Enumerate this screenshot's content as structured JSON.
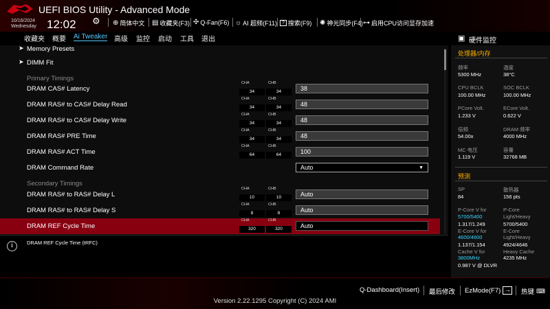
{
  "header": {
    "title": "UEFI BIOS Utility - Advanced Mode",
    "date": "10/16/2024",
    "day": "Wednesday",
    "time": "12:02",
    "items": [
      {
        "icon": "globe-icon",
        "label": "简体中文"
      },
      {
        "icon": "favorites-icon",
        "label": "收藏夹(F3)"
      },
      {
        "icon": "fan-icon",
        "label": "Q-Fan(F6)"
      },
      {
        "icon": "ai-icon",
        "label": "AI 超频(F11)"
      },
      {
        "icon": "help-icon",
        "label": "搜索(F9)"
      },
      {
        "icon": "aura-icon",
        "label": "神光同步(F4)"
      },
      {
        "icon": "cpu-access-icon",
        "label": "启用CPU访问显存加速"
      }
    ]
  },
  "menu": {
    "items": [
      "收藏夹",
      "概要",
      "Ai Tweaker",
      "高级",
      "监控",
      "启动",
      "工具",
      "退出"
    ],
    "active": "Ai Tweaker"
  },
  "main": {
    "rows": [
      {
        "type": "link",
        "label": "Memory Presets"
      },
      {
        "type": "link",
        "label": "DIMM Fit"
      },
      {
        "type": "group",
        "label": "Primary Timings"
      },
      {
        "type": "setting",
        "label": "DRAM CAS# Latency",
        "cha_tag": "CHA",
        "chb_tag": "CHB",
        "cha": "34",
        "chb": "34",
        "value": "38"
      },
      {
        "type": "setting",
        "label": "DRAM RAS# to CAS# Delay Read",
        "cha_tag": "CHA",
        "chb_tag": "CHB",
        "cha": "34",
        "chb": "34",
        "value": "48"
      },
      {
        "type": "setting",
        "label": "DRAM RAS# to CAS# Delay Write",
        "cha_tag": "CHA",
        "chb_tag": "CHB",
        "cha": "34",
        "chb": "34",
        "value": "48"
      },
      {
        "type": "setting",
        "label": "DRAM RAS# PRE Time",
        "cha_tag": "CHA",
        "chb_tag": "CHB",
        "cha": "34",
        "chb": "34",
        "value": "48"
      },
      {
        "type": "setting",
        "label": "DRAM RAS# ACT Time",
        "cha_tag": "CHA",
        "chb_tag": "CHB",
        "cha": "64",
        "chb": "64",
        "value": "100"
      },
      {
        "type": "dropdown",
        "label": "DRAM Command Rate",
        "value": "Auto"
      },
      {
        "type": "group",
        "label": "Secondary Timings"
      },
      {
        "type": "setting",
        "label": "DRAM RAS# to RAS# Delay L",
        "cha_tag": "CHA",
        "chb_tag": "CHB",
        "cha": "10",
        "chb": "10",
        "value": "Auto"
      },
      {
        "type": "setting",
        "label": "DRAM RAS# to RAS# Delay S",
        "cha_tag": "CHA",
        "chb_tag": "CHB",
        "cha": "8",
        "chb": "8",
        "value": "Auto"
      },
      {
        "type": "setting",
        "label": "DRAM REF Cycle Time",
        "cha_tag": "CHA",
        "chb_tag": "CHB",
        "cha": "320",
        "chb": "320",
        "value": "Auto",
        "selected": true
      }
    ]
  },
  "help": {
    "text": "DRAM REF Cycle Time (tRFC)"
  },
  "hw_monitor": {
    "title": "硬件监控",
    "cpu_mem": {
      "heading": "处理器/内存",
      "freq_label": "频率",
      "freq_value": "5300 MHz",
      "temp_label": "温度",
      "temp_value": "38°C",
      "bclk_label": "CPU BCLK",
      "bclk_value": "100.00 MHz",
      "soc_bclk_label": "SOC BCLK",
      "soc_bclk_value": "100.00 MHz",
      "pcore_label": "PCore Volt.",
      "pcore_value": "1.233 V",
      "ecore_label": "ECore Volt.",
      "ecore_value": "0.622 V",
      "ratio_label": "倍频",
      "ratio_value": "54.00x",
      "dram_freq_label": "DRAM 频率",
      "dram_freq_value": "4000 MHz",
      "mc_label": "MC 电压",
      "mc_value": "1.119 V",
      "cap_label": "容量",
      "cap_value": "32768 MB"
    },
    "prediction": {
      "heading": "预测",
      "sp_label": "SP",
      "sp_value": "84",
      "cooler_label": "散热器",
      "cooler_value": "156 pts",
      "pv_label": "P-Core V for",
      "pv_freq": "5700/5400",
      "pv_value": "1.317/1.249",
      "plh_label1": "P-Core",
      "plh_label2": "Light/Heavy",
      "plh_value": "5700/5400",
      "ev_label": "E-Core V for",
      "ev_freq": "4600/4600",
      "ev_value": "1.137/1.154",
      "elh_label1": "E-Core",
      "elh_label2": "Light/Heavy",
      "elh_value": "4924/4646",
      "cv_label": "Cache V for",
      "cv_freq": "3800MHz",
      "cv_value": "0.987 V @ DLVR",
      "hc_label": "Heavy Cache",
      "hc_value": "4235 MHz"
    }
  },
  "footer": {
    "items": [
      "Q-Dashboard(Insert)",
      "最后修改",
      "EzMode(F7)",
      "热键"
    ],
    "copyright": "Version 2.22.1295 Copyright (C) 2024 AMI"
  }
}
